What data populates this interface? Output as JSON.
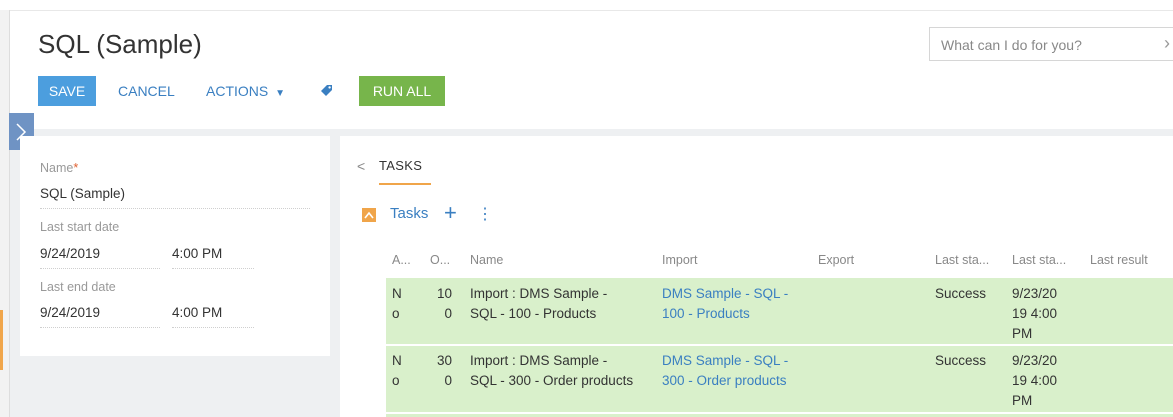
{
  "page": {
    "title": "SQL (Sample)",
    "search_placeholder": "What can I do for you?"
  },
  "toolbar": {
    "save": "SAVE",
    "cancel": "CANCEL",
    "actions": "ACTIONS",
    "run_all": "RUN ALL"
  },
  "fields": {
    "name_label": "Name",
    "required_mark": "*",
    "name_value": "SQL (Sample)",
    "last_start_label": "Last start date",
    "last_start_date": "9/24/2019",
    "last_start_time": "4:00 PM",
    "last_end_label": "Last end date",
    "last_end_date": "9/24/2019",
    "last_end_time": "4:00 PM"
  },
  "tabs": {
    "tasks": "TASKS"
  },
  "detail": {
    "title": "Tasks",
    "add": "+",
    "menu": "⋮"
  },
  "table": {
    "columns": [
      "A...",
      "O...",
      "Name",
      "Import",
      "Export",
      "Last sta...",
      "Last sta...",
      "Last result"
    ],
    "rows": [
      {
        "active": [
          "N",
          "o"
        ],
        "order": [
          "10",
          "0"
        ],
        "name": [
          "Import : DMS Sample -",
          "SQL - 100 - Products"
        ],
        "import": [
          "DMS Sample - SQL -",
          "100 - Products"
        ],
        "export": "",
        "status": "Success",
        "date": [
          "9/23/20",
          "19 4:00",
          "PM"
        ],
        "result": ""
      },
      {
        "active": [
          "N",
          "o"
        ],
        "order": [
          "30",
          "0"
        ],
        "name": [
          "Import : DMS Sample -",
          "SQL - 300 - Order products"
        ],
        "import": [
          "DMS Sample - SQL -",
          "300 - Order products"
        ],
        "export": "",
        "status": "Success",
        "date": [
          "9/23/20",
          "19 4:00",
          "PM"
        ],
        "result": ""
      }
    ]
  },
  "colors": {
    "save": "#4c9ede",
    "run_all": "#77b54b",
    "link": "#3a7fc1",
    "accent": "#f0a54a",
    "row_bg": "#d9f0cb"
  }
}
